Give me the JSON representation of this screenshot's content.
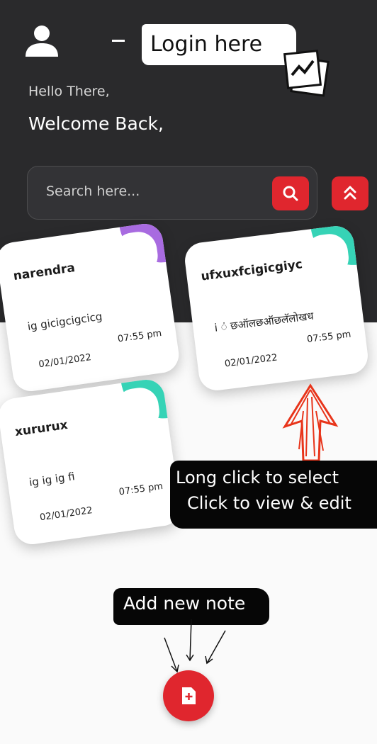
{
  "header": {
    "greeting": "Hello There,",
    "welcome": "Welcome Back,"
  },
  "search": {
    "placeholder": "Search here..."
  },
  "notes": [
    {
      "title": "narendra",
      "body": "ig gicigcigcicg",
      "date": "02/01/2022",
      "time": "07:55 pm",
      "accent": "#a86be0"
    },
    {
      "title": "ufxuxfcigicgiyc",
      "body": "i  ं छऑलछऑछलॅलोखध",
      "date": "02/01/2022",
      "time": "07:55 pm",
      "accent": "#36d3b6"
    },
    {
      "title": "xururux",
      "body": "ig ig ig fi",
      "date": "02/01/2022",
      "time": "07:55 pm",
      "accent": "#36d3b6"
    }
  ],
  "annotations": {
    "login": "Login here",
    "hint_line1": "Long click to select",
    "hint_line2": "Click to view & edit",
    "add_note": "Add new note"
  },
  "colors": {
    "header_bg": "#2a2a2c",
    "accent_red": "#e0262e"
  }
}
